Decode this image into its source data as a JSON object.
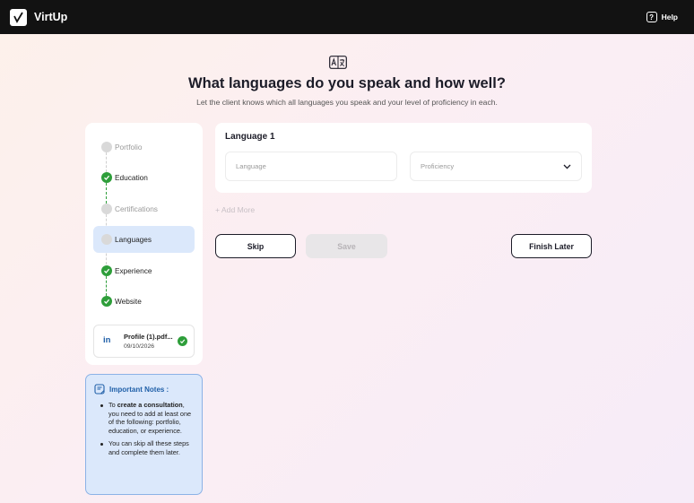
{
  "app": {
    "name": "VirtUp"
  },
  "topbar": {
    "help_label": "Help"
  },
  "header": {
    "title": "What languages do you speak and how well?",
    "subtitle": "Let the client knows which all languages you speak and your level of proficiency in each."
  },
  "steps": [
    {
      "label": "Portfolio",
      "state": "pending"
    },
    {
      "label": "Education",
      "state": "done"
    },
    {
      "label": "Certifications",
      "state": "pending"
    },
    {
      "label": "Languages",
      "state": "active"
    },
    {
      "label": "Experience",
      "state": "done"
    },
    {
      "label": "Website",
      "state": "done"
    }
  ],
  "file": {
    "name": "Profile (1).pdf...",
    "date": "09/10/2026",
    "source_icon": "linkedin-icon"
  },
  "notes": {
    "title": "Important Notes :",
    "item1_pre": "To ",
    "item1_bold": "create a consultation",
    "item1_post": ", you need to add at least one of the following: portfolio, education, or experience.",
    "item2": "You can skip all these steps and complete them later."
  },
  "language_card": {
    "title": "Language 1",
    "language_placeholder": "Language",
    "proficiency_placeholder": "Proficiency"
  },
  "add_more_label": "+ Add More",
  "buttons": {
    "skip": "Skip",
    "save": "Save",
    "finish_later": "Finish Later"
  },
  "colors": {
    "accent": "#2e9e3a",
    "active_step": "#dbe8fb",
    "dark": "#121212",
    "note_title": "#1f5fa8"
  }
}
